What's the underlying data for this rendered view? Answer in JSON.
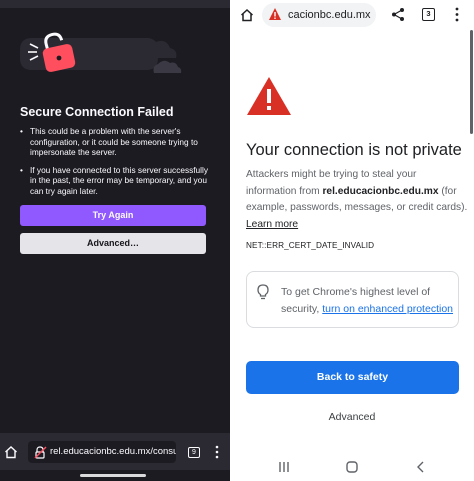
{
  "left_pane": {
    "title": "Secure Connection Failed",
    "bullets": [
      "This could be a problem with the server's configuration, or it could be someone trying to impersonate the server.",
      "If you have connected to this server successfully in the past, the error may be temporary, and you can try again later."
    ],
    "try_again_label": "Try Again",
    "advanced_label": "Advanced…",
    "url": "rel.educacionbc.edu.mx/consu",
    "tab_count": "9",
    "colors": {
      "background": "#1c1b22",
      "primary": "#9059ff",
      "secondary": "#e4e4e9"
    }
  },
  "right_pane": {
    "omnibox_url": "cacionbc.edu.mx",
    "tab_count": "3",
    "heading": "Your connection is not private",
    "desc_prefix": "Attackers might be trying to steal your information from ",
    "desc_domain": "rel.educacionbc.edu.mx",
    "desc_suffix": " (for example, passwords, messages, or credit cards).",
    "learn_more": "Learn more",
    "error_code": "NET::ERR_CERT_DATE_INVALID",
    "card_text": "To get Chrome's highest level of security, ",
    "card_link": "turn on enhanced protection",
    "back_to_safety": "Back to safety",
    "advanced": "Advanced",
    "colors": {
      "accent": "#1a73e8",
      "warning": "#d93025"
    }
  }
}
